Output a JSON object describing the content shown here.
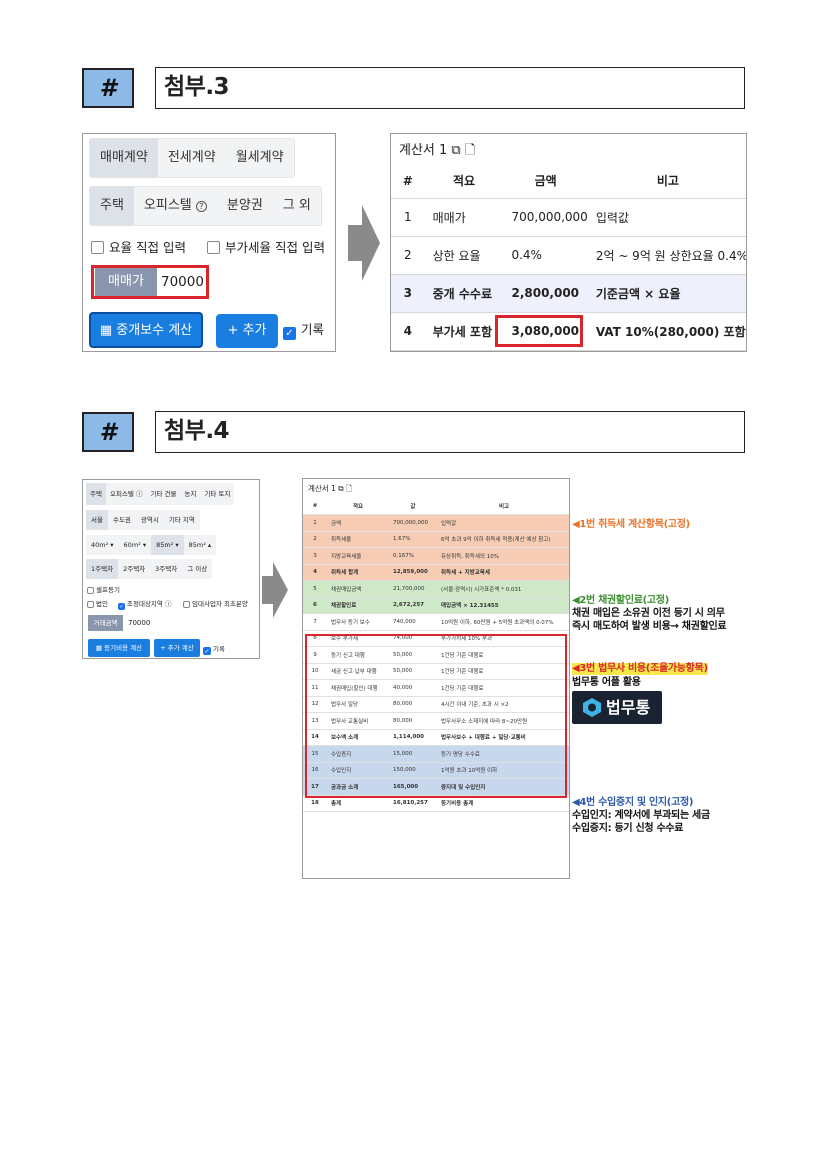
{
  "section3": {
    "hash": "#",
    "title": "첨부.3",
    "contract_tabs": [
      "매매계약",
      "전세계약",
      "월세계약"
    ],
    "property_tabs": [
      "주택",
      "오피스텔",
      "분양권",
      "그 외"
    ],
    "checkbox_rate": "요율 직접 입력",
    "checkbox_vat": "부가세율 직접 입력",
    "price_label": "매매가",
    "price_value": "70000",
    "calc_button": "중개보수 계산",
    "add_button": "+ 추가",
    "record_label": "기록",
    "calc_title": "계산서 1",
    "table_headers": [
      "#",
      "적요",
      "금액",
      "비고"
    ],
    "rows": [
      [
        "1",
        "매매가",
        "700,000,000",
        "입력값"
      ],
      [
        "2",
        "상한 요율",
        "0.4%",
        "2억 ~ 9억 원 상한요율 0.4%"
      ],
      [
        "3",
        "중개 수수료",
        "2,800,000",
        "기준금액 × 요율"
      ],
      [
        "4",
        "부가세 포함",
        "3,080,000",
        "VAT 10%(280,000) 포함"
      ]
    ]
  },
  "section4": {
    "hash": "#",
    "title": "첨부.4",
    "type_tabs": [
      "주택",
      "오피스텔",
      "기타 건물",
      "농지",
      "기타 토지"
    ],
    "region_tabs": [
      "서울",
      "수도권",
      "광역시",
      "기타 지역"
    ],
    "area_tabs": [
      "40m² ▾",
      "60m² ▾",
      "85m² ▾",
      "85m² ▴"
    ],
    "owner_tabs": [
      "1주택자",
      "2주택자",
      "3주택자",
      "그 이상"
    ],
    "chk_self": "셀프등기",
    "chk_corp": "법인",
    "chk_adjust": "조정대상지역",
    "chk_rental": "임대사업자 최초분양",
    "amount_label": "거래금액",
    "amount_value": "70000",
    "calc_button": "등기비용 계산",
    "add_button": "+ 추가 계산",
    "record_label": "기록",
    "calc_title": "계산서 1",
    "table_headers": [
      "#",
      "적요",
      "값",
      "비고"
    ],
    "rows": [
      [
        "1",
        "금액",
        "700,000,000",
        "입력값"
      ],
      [
        "2",
        "취득세율",
        "1.67%",
        "6억 초과 9억 이하 취득세 적용(계산 예상 참고)"
      ],
      [
        "3",
        "지방교육세율",
        "0.167%",
        "유상취득, 취득세의 10%"
      ],
      [
        "4",
        "취득세 합계",
        "12,859,000",
        "취득세 + 지방교육세"
      ],
      [
        "5",
        "채권매입금액",
        "21,700,000",
        "(서울·광역시) 시가표준액 * 0.031"
      ],
      [
        "6",
        "채권할인료",
        "2,672,257",
        "매입금액 × 12.31455"
      ],
      [
        "7",
        "법무사 등기 보수",
        "740,000",
        "10억원 이하, 60만원 + 5억원 초과액의 0.07%"
      ],
      [
        "8",
        "보수 부가세",
        "74,000",
        "부가가치세 10% 부과"
      ],
      [
        "9",
        "등기 신고 대행",
        "50,000",
        "1건당 기준 대행료"
      ],
      [
        "10",
        "세금 신고·납부 대행",
        "50,000",
        "1건당 기준 대행료"
      ],
      [
        "11",
        "채권매입(할인) 대행",
        "40,000",
        "1건당 기준 대행료"
      ],
      [
        "12",
        "법무사 일당",
        "80,000",
        "4시간 이내 기준, 초과 시 ×2"
      ],
      [
        "13",
        "법무사 교통실비",
        "80,000",
        "법무사무소 소재지에 따라 8~20만원"
      ],
      [
        "14",
        "보수액 소계",
        "1,114,000",
        "법무사보수 + 대행료 + 일당·교통비"
      ],
      [
        "15",
        "수입증지",
        "15,000",
        "등기 명당 수수료"
      ],
      [
        "16",
        "수입인지",
        "150,000",
        "1억원 초과 10억원 이하"
      ],
      [
        "17",
        "공과금 소계",
        "165,000",
        "증지대 및 수입인지"
      ],
      [
        "18",
        "총계",
        "16,810,257",
        "등기비용 총계"
      ]
    ],
    "annotations": {
      "a1": "◀1번 취득세 계산항목(고정)",
      "a2_title": "◀2번 채권할인료(고정)",
      "a2_line1": "채권 매입은 소유권 이전 등기 시 의무",
      "a2_line2": "즉시 매도하여 발생 비용→ 채권할인료",
      "a3_title": "◀3번 법무사 비용(조율가능항목)",
      "a3_line1": "법무통 어플 활용",
      "app_name": "법무통",
      "a4_title": "◀4번 수입증지 및 인지(고정)",
      "a4_line1": "수입인지: 계약서에 부과되는 세금",
      "a4_line2": "수입증지: 등기 신청 수수료"
    },
    "colors": {
      "orange": "#e8742a",
      "green": "#3a8f2e",
      "red": "#d9262c",
      "blue": "#2b5aa8",
      "app_bg": "#1a2332",
      "app_accent": "#3fb3e6"
    }
  }
}
